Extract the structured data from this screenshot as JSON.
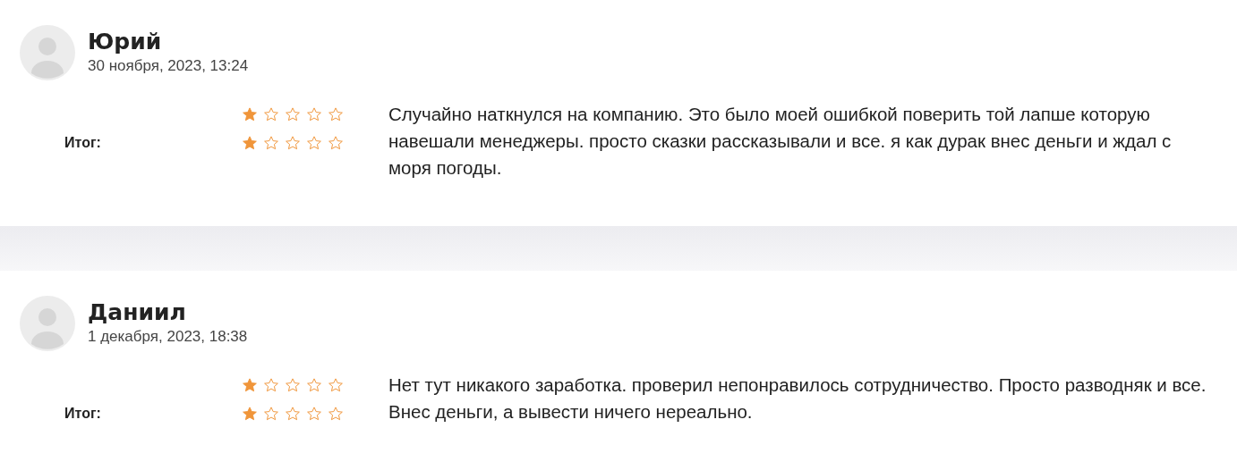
{
  "reviews": [
    {
      "name": "Юрий",
      "date": "30 ноября, 2023, 13:24",
      "ratings": [
        {
          "stars": 1
        },
        {
          "label": "Итог:",
          "stars": 1
        }
      ],
      "text": "Случайно наткнулся на компанию. Это было моей ошибкой поверить той лапше которую навешали менеджеры. просто сказки рассказывали и все. я как дурак внес деньги и ждал с моря погоды."
    },
    {
      "name": "Даниил",
      "date": "1 декабря, 2023, 18:38",
      "ratings": [
        {
          "stars": 1
        },
        {
          "label": "Итог:",
          "stars": 1
        }
      ],
      "text": "Нет тут никакого заработка. проверил непонравилось сотрудничество. Просто разводняк и все. Внес деньги, а вывести ничего нереально."
    }
  ]
}
